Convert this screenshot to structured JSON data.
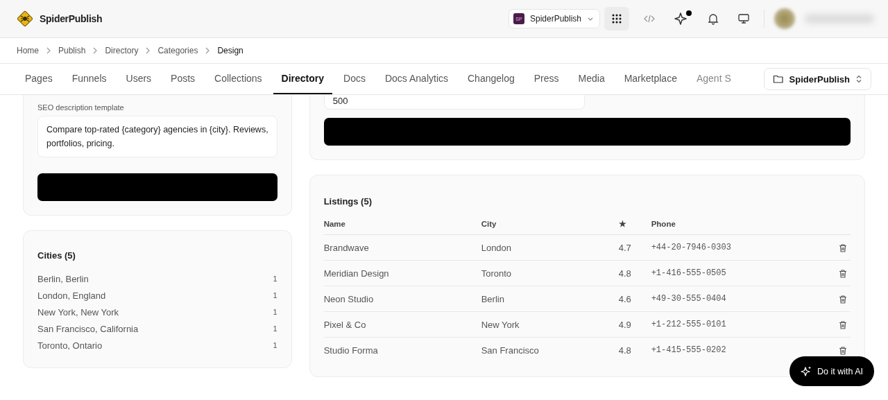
{
  "app": {
    "name": "SpiderPublish"
  },
  "header": {
    "workspace": {
      "initials": "SP",
      "name": "SpiderPublish"
    },
    "notification_dot": true
  },
  "breadcrumb": [
    {
      "label": "Home"
    },
    {
      "label": "Publish"
    },
    {
      "label": "Directory"
    },
    {
      "label": "Categories"
    },
    {
      "label": "Design"
    }
  ],
  "tabs": [
    {
      "label": "Pages",
      "selected": false
    },
    {
      "label": "Funnels",
      "selected": false
    },
    {
      "label": "Users",
      "selected": false
    },
    {
      "label": "Posts",
      "selected": false
    },
    {
      "label": "Collections",
      "selected": false
    },
    {
      "label": "Directory",
      "selected": true
    },
    {
      "label": "Docs",
      "selected": false
    },
    {
      "label": "Docs Analytics",
      "selected": false
    },
    {
      "label": "Changelog",
      "selected": false
    },
    {
      "label": "Press",
      "selected": false
    },
    {
      "label": "Media",
      "selected": false
    },
    {
      "label": "Marketplace",
      "selected": false
    },
    {
      "label": "Agent S",
      "selected": false
    }
  ],
  "project_selector": {
    "label": "SpiderPublish"
  },
  "seo_card": {
    "label": "SEO description template",
    "value": "Compare top-rated {category} agencies in {city}. Reviews, portfolios, pricing."
  },
  "cities": {
    "title": "Cities (5)",
    "items": [
      {
        "name": "Berlin, Berlin",
        "count": "1"
      },
      {
        "name": "London, England",
        "count": "1"
      },
      {
        "name": "New York, New York",
        "count": "1"
      },
      {
        "name": "San Francisco, California",
        "count": "1"
      },
      {
        "name": "Toronto, Ontario",
        "count": "1"
      }
    ]
  },
  "settings_card": {
    "field_value": "500"
  },
  "listings": {
    "title": "Listings (5)",
    "columns": [
      "Name",
      "City",
      "★",
      "Phone"
    ],
    "rows": [
      {
        "name": "Brandwave",
        "city": "London",
        "rating": "4.7",
        "phone": "+44-20-7946-0303"
      },
      {
        "name": "Meridian Design",
        "city": "Toronto",
        "rating": "4.8",
        "phone": "+1-416-555-0505"
      },
      {
        "name": "Neon Studio",
        "city": "Berlin",
        "rating": "4.6",
        "phone": "+49-30-555-0404"
      },
      {
        "name": "Pixel & Co",
        "city": "New York",
        "rating": "4.9",
        "phone": "+1-212-555-0101"
      },
      {
        "name": "Studio Forma",
        "city": "San Francisco",
        "rating": "4.8",
        "phone": "+1-415-555-0202"
      }
    ]
  },
  "ai_button": {
    "label": "Do it with AI"
  }
}
